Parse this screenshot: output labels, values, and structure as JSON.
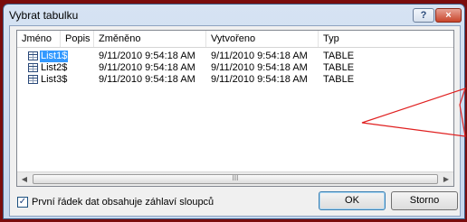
{
  "window": {
    "title": "Vybrat tabulku",
    "help_glyph": "?",
    "close_glyph": "×"
  },
  "table": {
    "columns": [
      "Jméno",
      "Popis",
      "Změněno",
      "Vytvořeno",
      "Typ"
    ],
    "rows": [
      {
        "name": "List1$",
        "description": "",
        "modified": "9/11/2010 9:54:18 AM",
        "created": "9/11/2010 9:54:18 AM",
        "type": "TABLE",
        "selected": true
      },
      {
        "name": "List2$",
        "description": "",
        "modified": "9/11/2010 9:54:18 AM",
        "created": "9/11/2010 9:54:18 AM",
        "type": "TABLE",
        "selected": false
      },
      {
        "name": "List3$",
        "description": "",
        "modified": "9/11/2010 9:54:18 AM",
        "created": "9/11/2010 9:54:18 AM",
        "type": "TABLE",
        "selected": false
      }
    ]
  },
  "scrollbar": {
    "left_glyph": "◀",
    "right_glyph": "▶",
    "grip_glyph": "III"
  },
  "checkbox": {
    "label": "První řádek dat obsahuje záhlaví sloupců",
    "checked": true,
    "check_glyph": "✓"
  },
  "buttons": {
    "ok": "OK",
    "cancel": "Storno"
  },
  "colors": {
    "annotation_arrow": "#e02020",
    "selection": "#3399ff",
    "background": "#7a0d0d"
  }
}
